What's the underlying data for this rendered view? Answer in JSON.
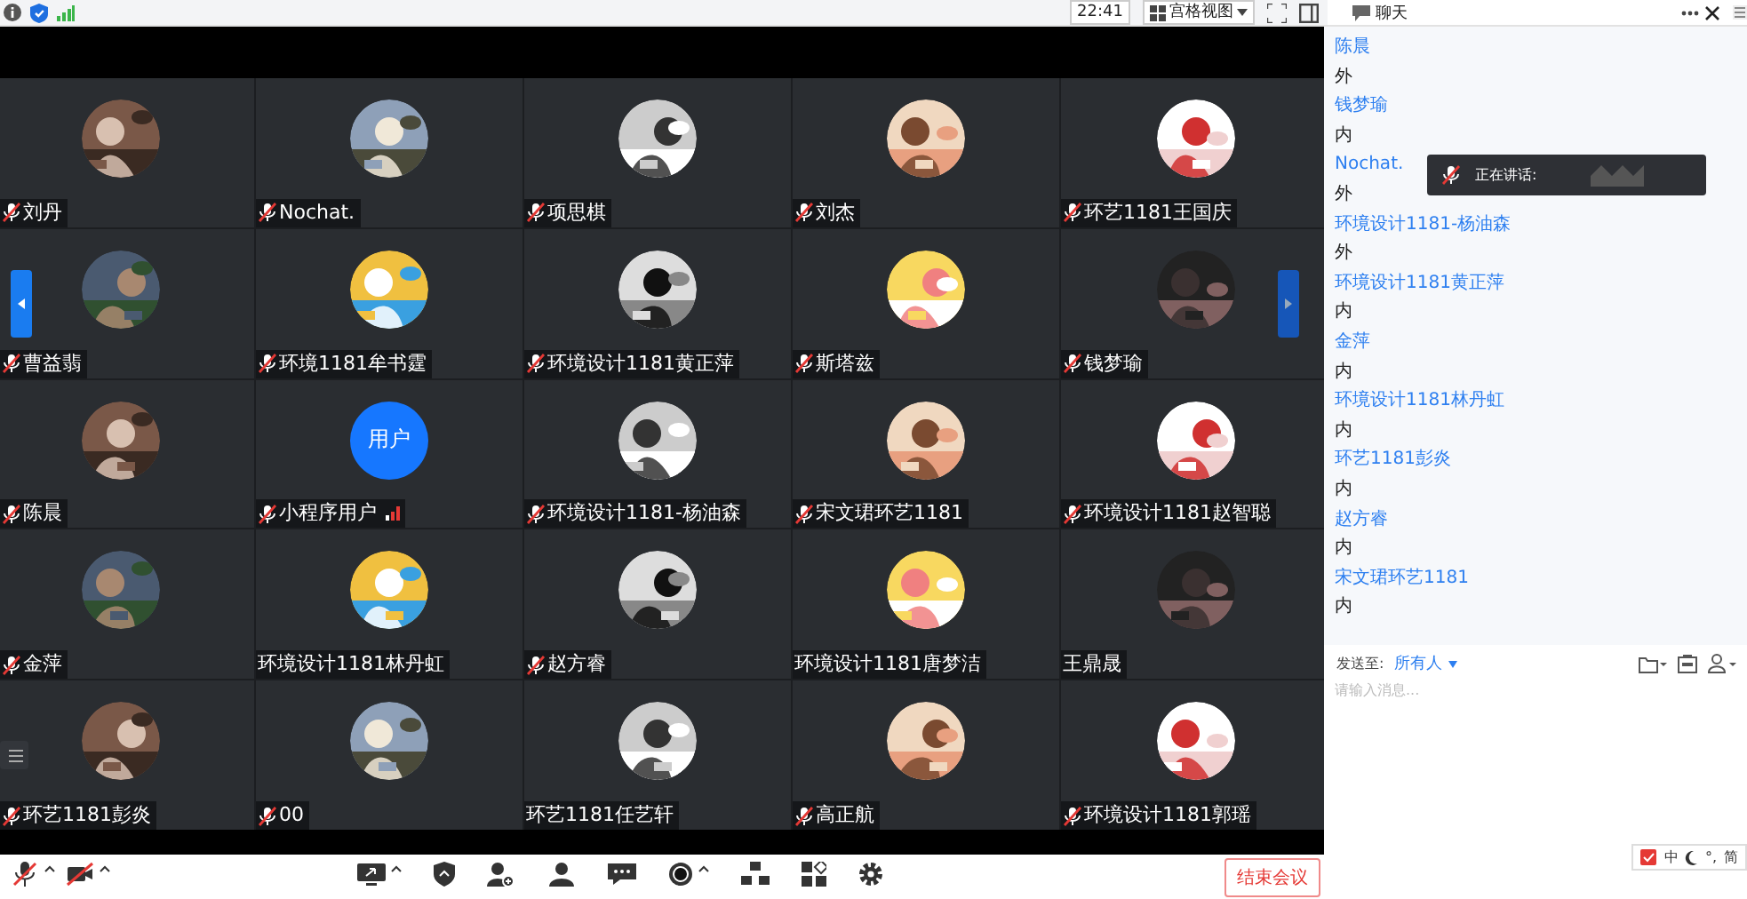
{
  "top_bar": {
    "time": "22:41",
    "view_label": "宫格视图"
  },
  "chat": {
    "title": "聊天",
    "messages": [
      {
        "sender": "陈晨",
        "text": "外"
      },
      {
        "sender": "钱梦瑜",
        "text": "内"
      },
      {
        "sender": "Nochat.",
        "text": "外"
      },
      {
        "sender": "环境设计1181-杨油森",
        "text": "外"
      },
      {
        "sender": "环境设计1181黄正萍",
        "text": "内"
      },
      {
        "sender": "金萍",
        "text": "内"
      },
      {
        "sender": "环境设计1181林丹虹",
        "text": "内"
      },
      {
        "sender": "环艺1181彭炎",
        "text": "内"
      },
      {
        "sender": "赵方睿",
        "text": "内"
      },
      {
        "sender": "宋文珺环艺1181",
        "text": "内"
      }
    ],
    "send_to_label": "发送至:",
    "recipient": "所有人",
    "placeholder": "请输入消息..."
  },
  "speaking_toast": {
    "label": "正在讲话:"
  },
  "tiles": [
    {
      "name": "刘丹",
      "muted": true,
      "kind": "picture"
    },
    {
      "name": "Nochat.",
      "muted": true,
      "kind": "picture"
    },
    {
      "name": "项思棋",
      "muted": true,
      "kind": "picture"
    },
    {
      "name": "刘杰",
      "muted": true,
      "kind": "picture"
    },
    {
      "name": "环艺1181王国庆",
      "muted": true,
      "kind": "picture"
    },
    {
      "name": "曹益翡",
      "muted": true,
      "kind": "picture"
    },
    {
      "name": "环境1181牟书霆",
      "muted": true,
      "kind": "picture"
    },
    {
      "name": "环境设计1181黄正萍",
      "muted": true,
      "kind": "picture"
    },
    {
      "name": "斯塔兹",
      "muted": true,
      "kind": "picture"
    },
    {
      "name": "钱梦瑜",
      "muted": true,
      "kind": "picture"
    },
    {
      "name": "陈晨",
      "muted": true,
      "kind": "picture"
    },
    {
      "name": "小程序用户",
      "muted": true,
      "kind": "text",
      "avatar_text": "用户",
      "signal": true
    },
    {
      "name": "环境设计1181-杨油森",
      "muted": true,
      "kind": "picture"
    },
    {
      "name": "宋文珺环艺1181",
      "muted": true,
      "kind": "picture"
    },
    {
      "name": "环境设计1181赵智聪",
      "muted": true,
      "kind": "picture"
    },
    {
      "name": "金萍",
      "muted": true,
      "kind": "picture"
    },
    {
      "name": "环境设计1181林丹虹",
      "muted": false,
      "kind": "picture"
    },
    {
      "name": "赵方睿",
      "muted": true,
      "kind": "picture"
    },
    {
      "name": "环境设计1181唐梦洁",
      "muted": false,
      "kind": "picture"
    },
    {
      "name": "王鼎晟",
      "muted": false,
      "kind": "picture"
    },
    {
      "name": "环艺1181彭炎",
      "muted": true,
      "kind": "picture"
    },
    {
      "name": "00",
      "muted": true,
      "kind": "picture"
    },
    {
      "name": "环艺1181任艺轩",
      "muted": false,
      "kind": "picture"
    },
    {
      "name": "高正航",
      "muted": true,
      "kind": "picture"
    },
    {
      "name": "环境设计1181郭瑶",
      "muted": true,
      "kind": "picture"
    }
  ],
  "toolbar": {
    "mic_muted": true,
    "video_off": true,
    "end_label": "结束会议"
  },
  "ime_bar": {
    "items": [
      "中",
      "°,",
      "简"
    ]
  }
}
